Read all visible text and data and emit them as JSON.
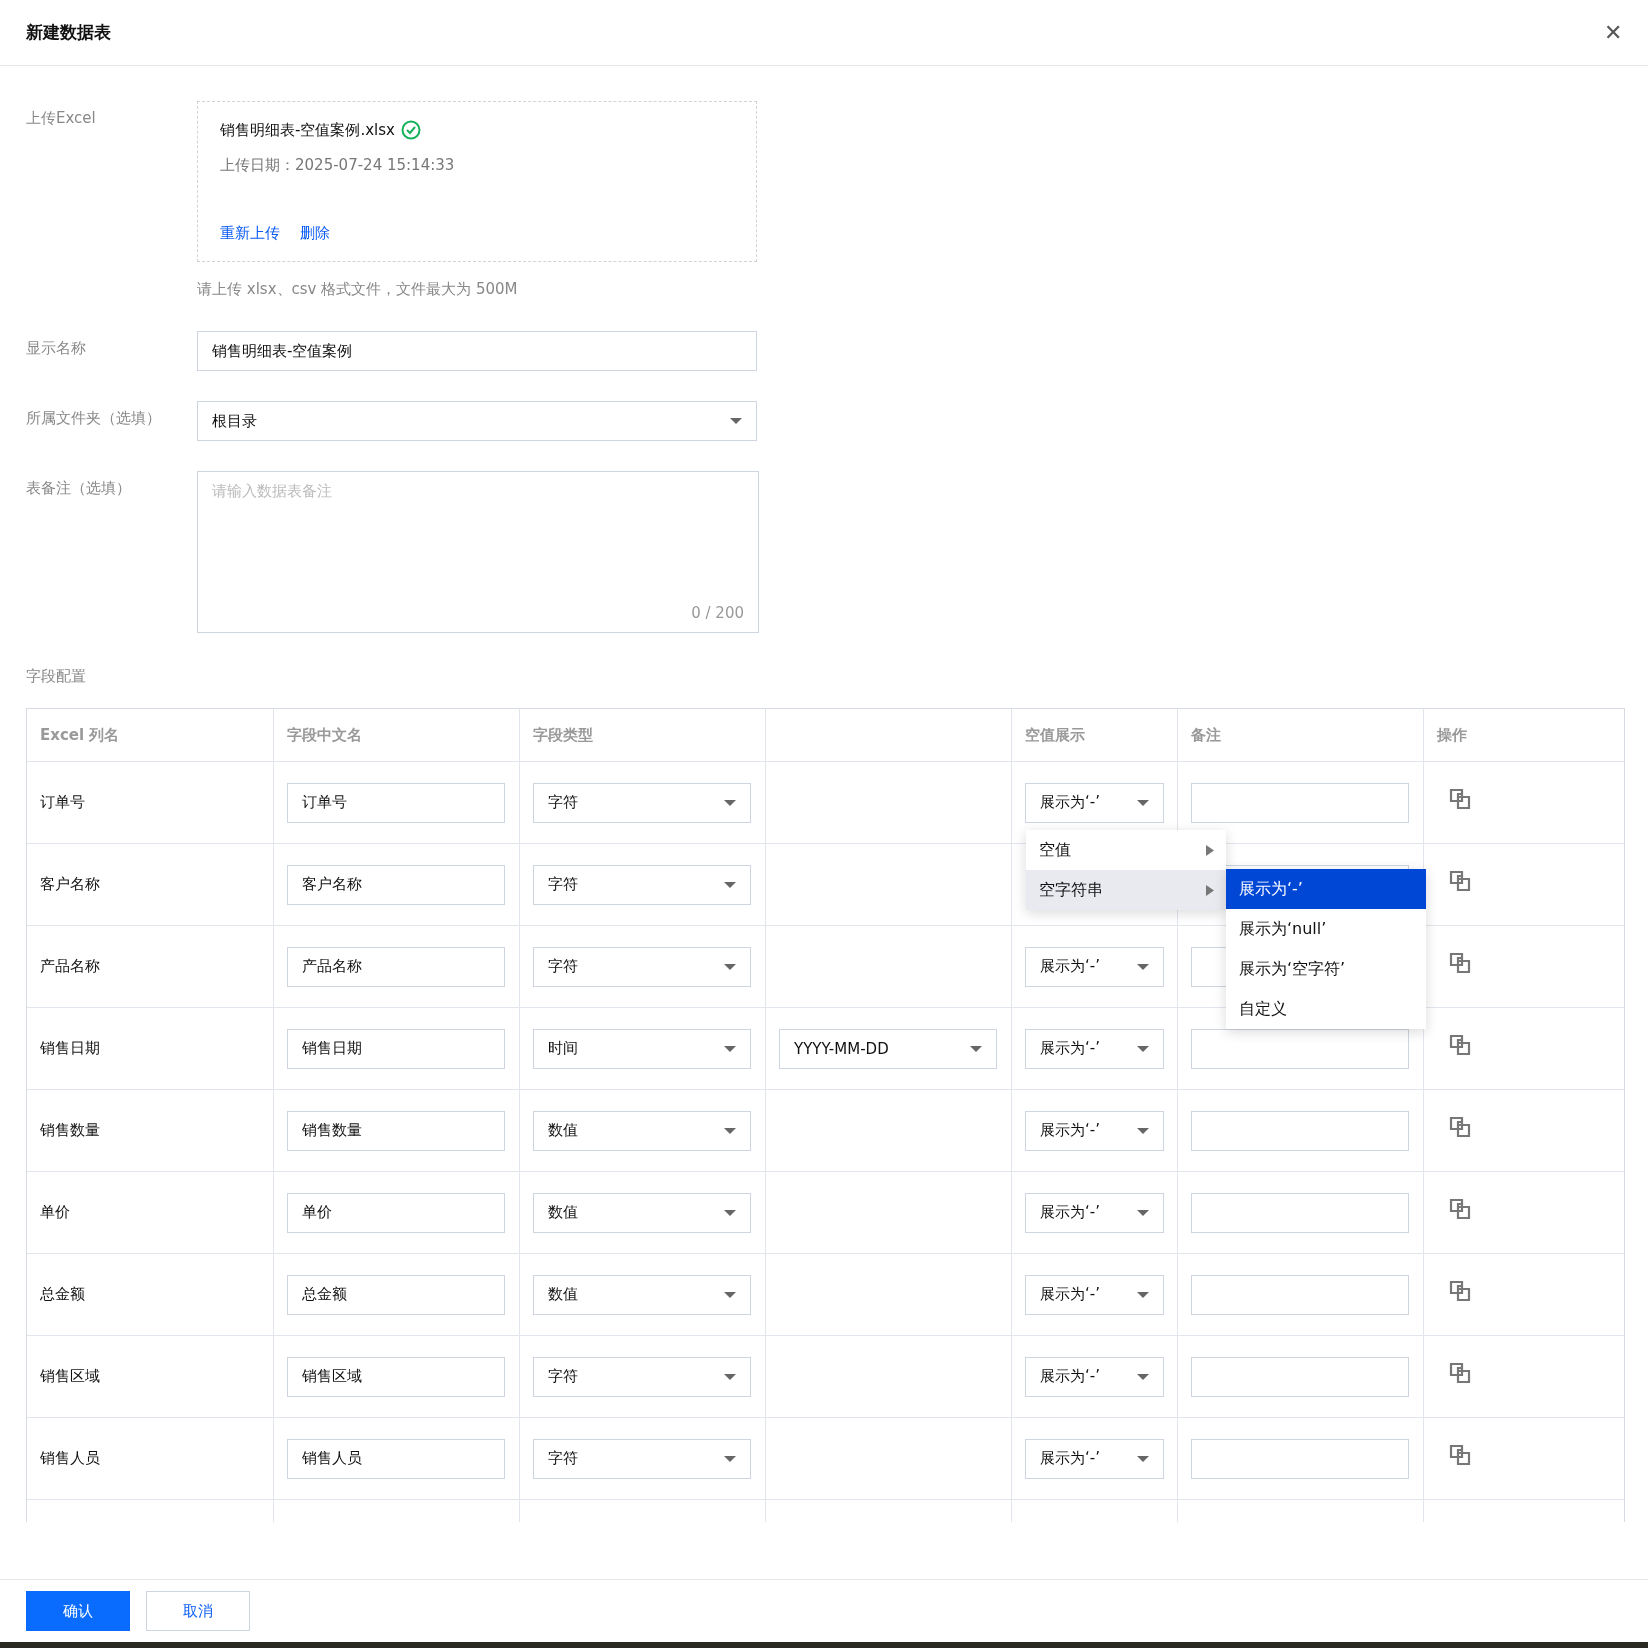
{
  "dialog": {
    "title": "新建数据表",
    "close": "✕"
  },
  "upload": {
    "label": "上传Excel",
    "file_name": "销售明细表-空值案例.xlsx",
    "uploaded": true,
    "upload_date": "上传日期：2025-07-24 15:14:33",
    "actions": [
      "重新上传",
      "删除"
    ],
    "hint": "请上传 xlsx、csv 格式文件，文件最大为 500M"
  },
  "display_name": {
    "label": "显示名称",
    "value": "销售明细表-空值案例"
  },
  "folder": {
    "label": "所属文件夹（选填）",
    "value": "根目录"
  },
  "remark": {
    "label": "表备注（选填）",
    "placeholder": "请输入数据表备注",
    "counter": "0 / 200"
  },
  "field_config": {
    "title": "字段配置",
    "columns": [
      "Excel 列名",
      "字段中文名",
      "字段类型",
      "",
      "空值展示",
      "备注",
      "操作"
    ],
    "rows": [
      {
        "excel_name": "订单号",
        "chinese_name": "订单号",
        "type": "字符",
        "null_display": "展示为‘-’"
      },
      {
        "excel_name": "客户名称",
        "chinese_name": "客户名称",
        "type": "字符"
      },
      {
        "excel_name": "产品名称",
        "chinese_name": "产品名称",
        "type": "字符",
        "null_display": "展示为‘-’"
      },
      {
        "excel_name": "销售日期",
        "chinese_name": "销售日期",
        "type": "时间",
        "format": "YYYY-MM-DD",
        "null_display": "展示为‘-’"
      },
      {
        "excel_name": "销售数量",
        "chinese_name": "销售数量",
        "type": "数值",
        "null_display": "展示为‘-’"
      },
      {
        "excel_name": "单价",
        "chinese_name": "单价",
        "type": "数值",
        "null_display": "展示为‘-’"
      },
      {
        "excel_name": "总金额",
        "chinese_name": "总金额",
        "type": "数值",
        "null_display": "展示为‘-’"
      },
      {
        "excel_name": "销售区域",
        "chinese_name": "销售区域",
        "type": "字符",
        "null_display": "展示为‘-’"
      },
      {
        "excel_name": "销售人员",
        "chinese_name": "销售人员",
        "type": "字符",
        "null_display": "展示为‘-’"
      }
    ],
    "menu": {
      "items": [
        {
          "label": "空值",
          "selected": false
        },
        {
          "label": "空字符串",
          "selected": true
        }
      ],
      "submenu": [
        {
          "label": "展示为‘-’",
          "selected": true
        },
        {
          "label": "展示为‘null’",
          "selected": false
        },
        {
          "label": "展示为‘空字符’",
          "selected": false
        },
        {
          "label": "自定义",
          "selected": false
        }
      ]
    }
  },
  "footer": {
    "confirm": "确认",
    "cancel": "取消"
  }
}
